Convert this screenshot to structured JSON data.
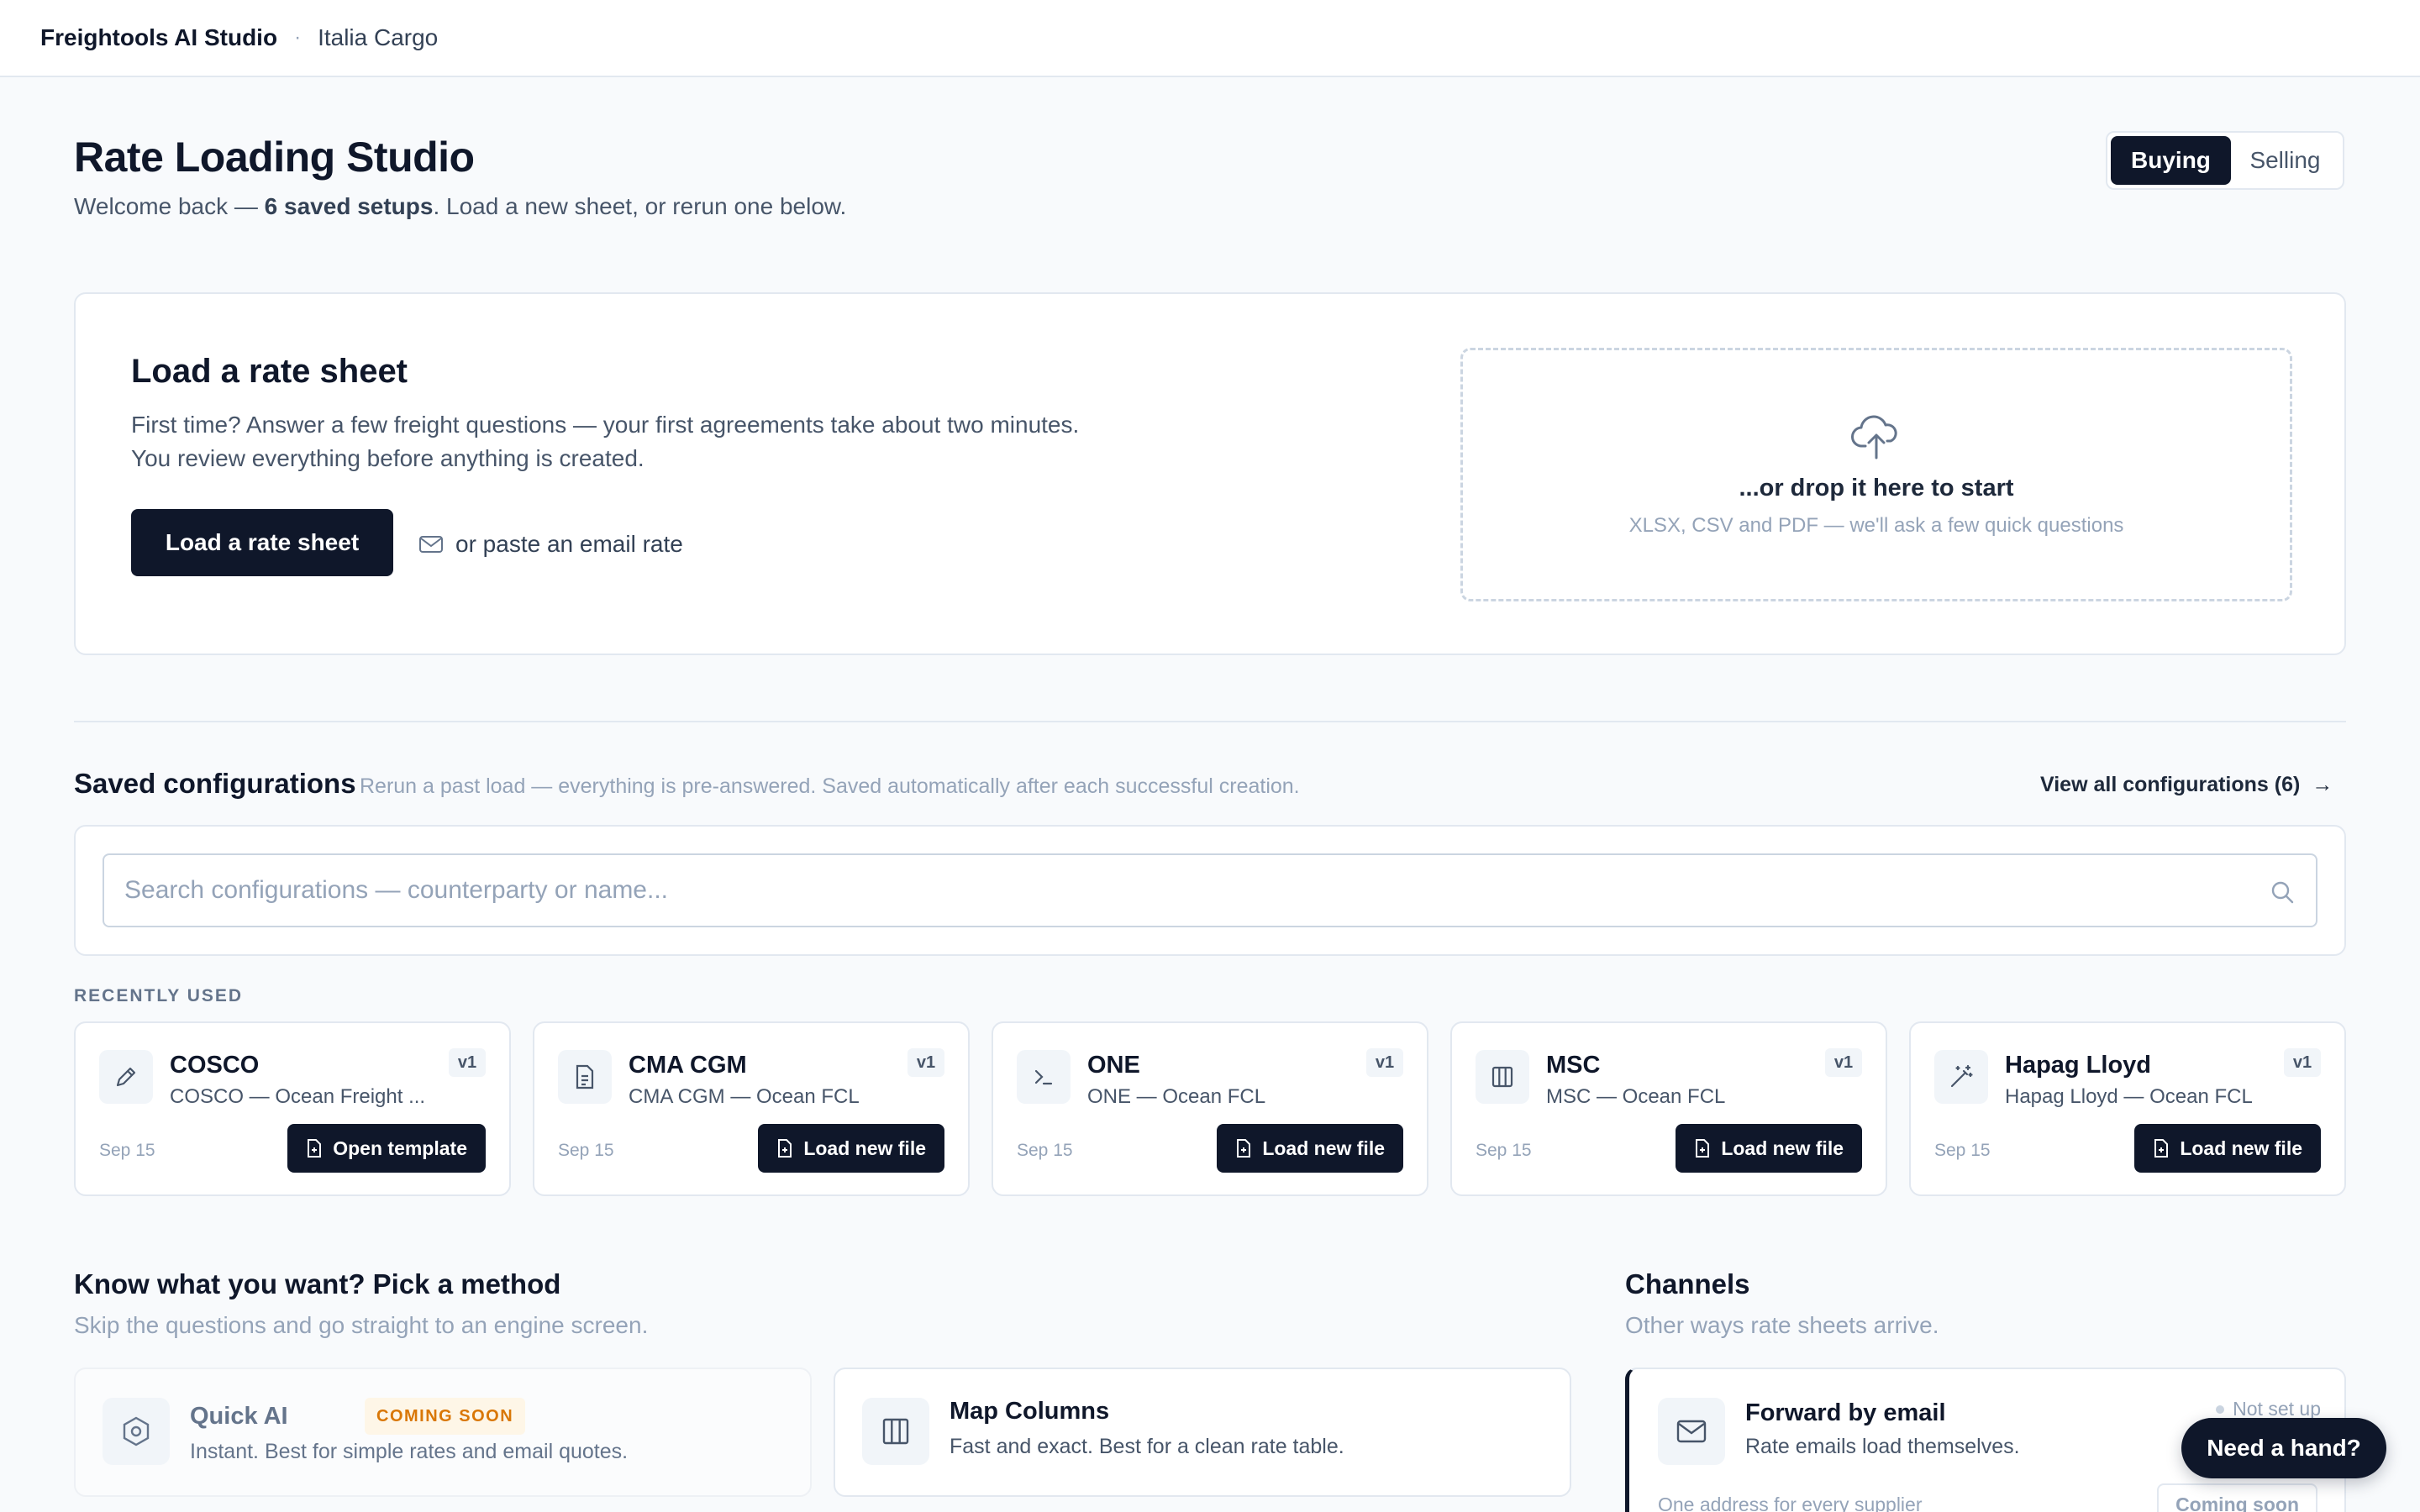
{
  "topbar": {
    "brand": "Freightools AI Studio",
    "separator": "·",
    "org": "Italia Cargo"
  },
  "header": {
    "title": "Rate Loading Studio",
    "welcome_prefix": "Welcome back — ",
    "saved_count_text": "6 saved setups",
    "welcome_suffix": ". Load a new sheet, or rerun one below.",
    "mode_toggle": {
      "buying": "Buying",
      "selling": "Selling",
      "active": "Buying"
    }
  },
  "load_card": {
    "title": "Load a rate sheet",
    "description": "First time? Answer a few freight questions — your first agreements take about two minutes. You review everything before anything is created.",
    "button": "Load a rate sheet",
    "paste_link": "or paste an email rate",
    "dropzone_main": "...or drop it here to start",
    "dropzone_sub": "XLSX, CSV and PDF — we'll ask a few quick questions"
  },
  "saved": {
    "title": "Saved configurations",
    "subtitle": "Rerun a past load — everything is pre-answered. Saved automatically after each successful creation.",
    "view_all": "View all configurations (6)",
    "search_placeholder": "Search configurations — counterparty or name...",
    "recent_label": "RECENTLY USED",
    "items": [
      {
        "name": "COSCO",
        "desc": "COSCO — Ocean Freight ...",
        "version": "v1",
        "date": "Sep 15",
        "action": "Open template",
        "icon": "pencil-icon"
      },
      {
        "name": "CMA CGM",
        "desc": "CMA CGM — Ocean FCL",
        "version": "v1",
        "date": "Sep 15",
        "action": "Load new file",
        "icon": "document-icon"
      },
      {
        "name": "ONE",
        "desc": "ONE — Ocean FCL",
        "version": "v1",
        "date": "Sep 15",
        "action": "Load new file",
        "icon": "terminal-icon"
      },
      {
        "name": "MSC",
        "desc": "MSC — Ocean FCL",
        "version": "v1",
        "date": "Sep 15",
        "action": "Load new file",
        "icon": "columns-icon"
      },
      {
        "name": "Hapag Lloyd",
        "desc": "Hapag Lloyd — Ocean FCL",
        "version": "v1",
        "date": "Sep 15",
        "action": "Load new file",
        "icon": "magic-wand-icon"
      }
    ]
  },
  "methods": {
    "title": "Know what you want? Pick a method",
    "subtitle": "Skip the questions and go straight to an engine screen.",
    "items": [
      {
        "name": "Quick AI",
        "badge": "COMING SOON",
        "desc": "Instant. Best for simple rates and email quotes.",
        "icon": "hexagon-icon"
      },
      {
        "name": "Map Columns",
        "desc": "Fast and exact. Best for a clean rate table.",
        "icon": "columns-icon"
      }
    ]
  },
  "channels": {
    "title": "Channels",
    "subtitle": "Other ways rate sheets arrive.",
    "item": {
      "name": "Forward by email",
      "desc": "Rate emails load themselves.",
      "status": "Not set up",
      "hint": "One address for every supplier",
      "action": "Coming soon",
      "icon": "mail-icon"
    }
  },
  "help_button": "Need a hand?",
  "colors": {
    "primary": "#0f172a",
    "badge_text": "#d97706",
    "badge_bg": "#fef6e7",
    "muted": "#94a3b8"
  }
}
